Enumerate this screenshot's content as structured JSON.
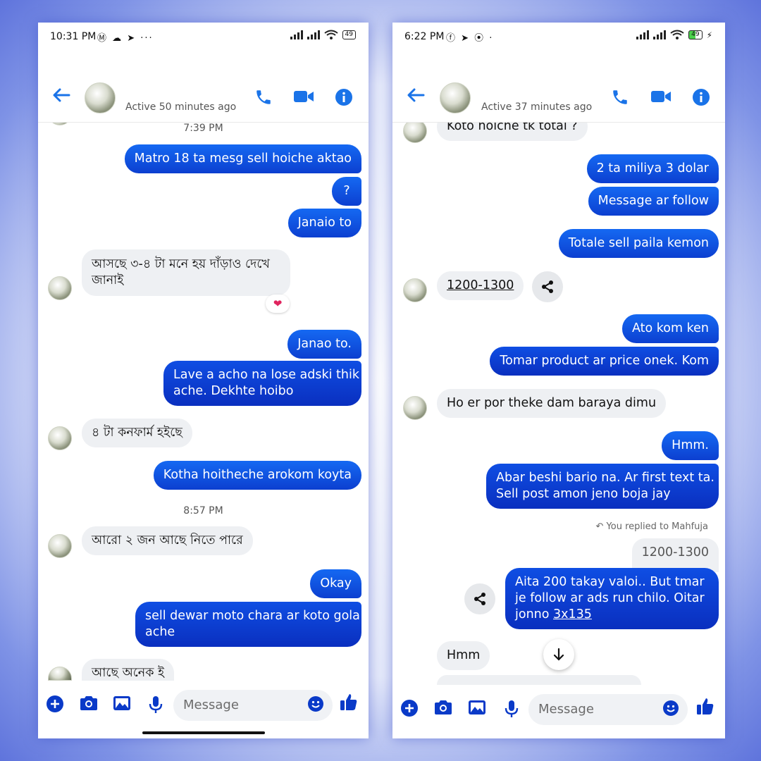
{
  "left": {
    "status": {
      "time": "10:31 PM",
      "apps": "Ⓜ ☁ ➤ ···",
      "battery": "49"
    },
    "header": {
      "active": "Active 50 minutes ago"
    },
    "stamps": [
      "7:39 PM",
      "8:57 PM"
    ],
    "messages": [
      "Matro 18 ta mesg sell hoiche aktao",
      "?",
      "Janaio to",
      "আসছে ৩-৪ টা মনে হয় দাঁড়াও দেখে",
      "জানাই",
      "Janao to.",
      "Lave a acho na lose adski thik",
      "ache.  Dekhte hoibo",
      "৪ টা কনফার্ম হইছে",
      "Kotha hoitheche arokom koyta",
      "আরো ২ জন আছে নিতে পারে",
      "Okay",
      "sell dewar moto chara ar koto gola",
      "ache",
      "আছে অনেক ই"
    ],
    "heart": "❤",
    "composer": {
      "placeholder": "Message"
    }
  },
  "right": {
    "status": {
      "time": "6:22 PM",
      "apps": "ⓕ ➤ ⦿ ·",
      "battery": "49"
    },
    "header": {
      "active": "Active 37 minutes ago"
    },
    "messages": [
      "Koto hoiche tk total ?",
      "2 ta miliya 3 dolar",
      "Message ar follow",
      "Totale sell paila kemon",
      "1200-1300",
      "Ato kom  ken",
      "Tomar product ar price onek. Kom",
      "Ho er por theke dam baraya dimu",
      "Hmm.",
      "Abar beshi bario na.  Ar first text ta.",
      "Sell post amon jeno boja jay",
      "Aita 200 takay valoi.. But tmar",
      "je follow ar ads run chilo. Oitar",
      "jonno ",
      "3x135",
      "Hmm"
    ],
    "replied": "You replied to Mahfuja",
    "quoted": "1200-1300",
    "composer": {
      "placeholder": "Message"
    }
  },
  "colors": {
    "accent": "#1a73e8",
    "bubble_out": "#0c3fd0",
    "bubble_in": "#eef0f3",
    "frame_glow": "#5f74dc"
  },
  "icons": [
    "back-arrow-icon",
    "phone-icon",
    "video-icon",
    "info-icon",
    "plus-icon",
    "camera-icon",
    "gallery-icon",
    "mic-icon",
    "emoji-icon",
    "like-icon",
    "share-icon",
    "arrow-down-icon",
    "reply-icon",
    "heart-icon"
  ]
}
